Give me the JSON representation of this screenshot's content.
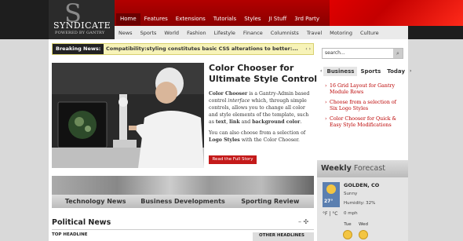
{
  "logo": {
    "letter": "S",
    "name": "SYNDICATE",
    "tagline": "POWERED BY GANTRY"
  },
  "main_nav": [
    "Home",
    "Features",
    "Extensions",
    "Tutorials",
    "Styles",
    "JI Stuff",
    "3rd Party"
  ],
  "main_nav_active": "Home",
  "sub_nav": [
    "News",
    "Sports",
    "World",
    "Fashion",
    "Lifestyle",
    "Finance",
    "Columnists",
    "Travel",
    "Motoring",
    "Culture"
  ],
  "breaking": {
    "label": "Breaking News:",
    "text": "Compatibility:styling constitutes basic CSS alterations to better:...",
    "arrows": "‹ ›"
  },
  "feature": {
    "title": "Color Chooser for Ultimate Style Control",
    "p1_b1": "Color Chooser",
    "p1_t1": " is a Gantry-Admin based control ",
    "p1_i": "interface",
    "p1_t2": " which, through simple controls, allows you to change all color and style elements of the template, such as ",
    "p1_b2": "text",
    "p1_t3": ", ",
    "p1_b3": "link",
    "p1_t4": " and ",
    "p1_b4": "background color",
    "p1_t5": ".",
    "p2_t1": "You can also choose from a selection of ",
    "p2_b1": "Logo Styles",
    "p2_t2": " with the Color Chooser.",
    "button": "Read the Full Story"
  },
  "tabs": [
    "Technology News",
    "Business Developments",
    "Sporting Review"
  ],
  "political": {
    "title": "Political News",
    "controls": "– ✣",
    "top_headline": "TOP HEADLINE",
    "other_headlines": "OTHER HEADLINES"
  },
  "search": {
    "placeholder": "search...",
    "button": "⌕"
  },
  "side_tabs": {
    "left_arrow": "‹",
    "items": [
      "Business",
      "Sports",
      "Today"
    ],
    "right_arrow": "›",
    "active": "Business"
  },
  "side_links": [
    "16 Grid Layout for Gantry Module Rows",
    "Choose from a selection of Six Logo Styles",
    "Color Chooser for Quick & Easy Style Modifications"
  ],
  "forecast": {
    "title_a": "Weekly",
    "title_b": " Forecast",
    "city": "GOLDEN, CO",
    "condition": "Sunny",
    "humidity": "Humidity: 32%",
    "temp": "27°",
    "units": "°F | °C",
    "wind": "0 mph",
    "days": [
      "Tue",
      "Wed"
    ]
  },
  "colors": {
    "accent": "#c41a1a",
    "nav_red": "#b30000",
    "link": "#bb0000"
  }
}
